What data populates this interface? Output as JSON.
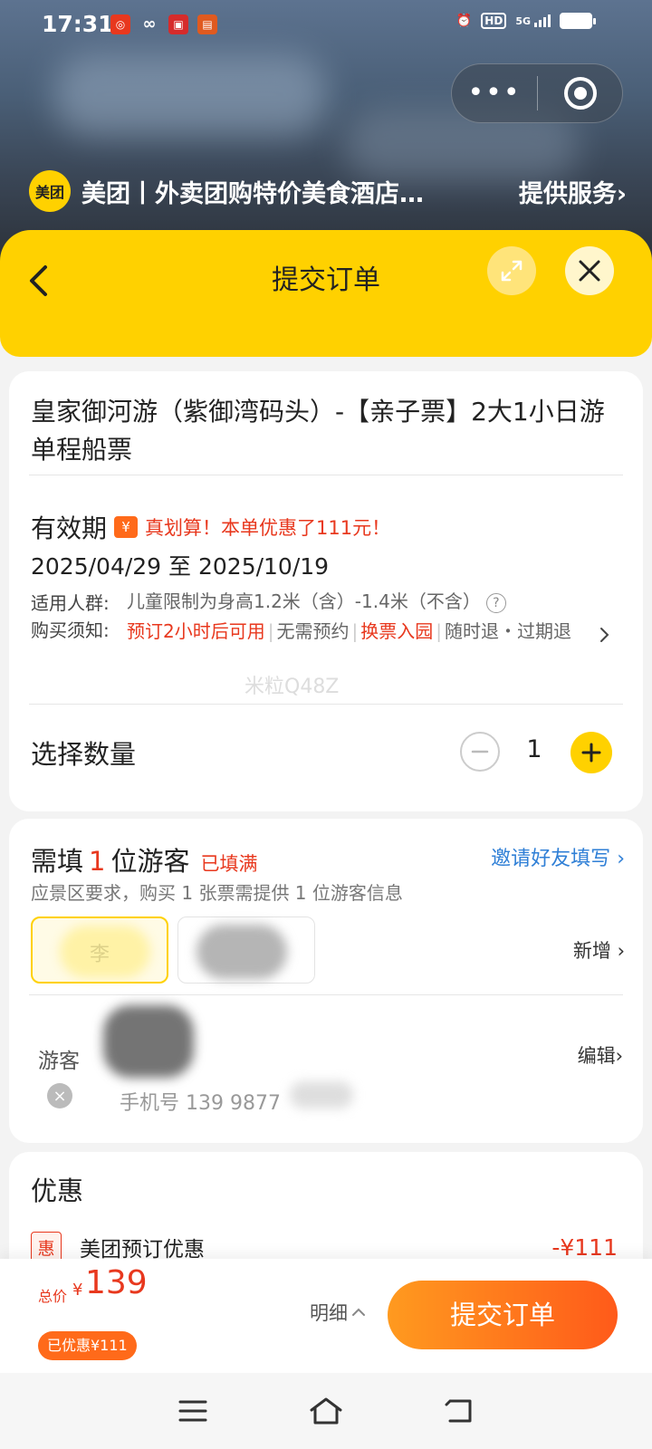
{
  "status_bar": {
    "time": "17:31",
    "notifications": [
      "app-notif-1",
      "app-notif-2",
      "app-notif-3",
      "app-notif-4"
    ],
    "hd_label": "HD",
    "network_label": "5G"
  },
  "mini_program": {
    "logo_text": "美团",
    "name": "美团丨外卖团购特价美食酒店…",
    "service_link": "提供服务"
  },
  "header": {
    "title": "提交订单"
  },
  "product": {
    "title": "皇家御河游（紫御湾码头）-【亲子票】2大1小日游单程船票",
    "validity_label": "有效期",
    "deal_icon": "¥",
    "deal_text": "真划算！本单优惠了111元！",
    "validity_dates": "2025/04/29 至 2025/10/19",
    "audience_label": "适用人群:",
    "audience_value": "儿童限制为身高1.2米（含）-1.4米（不含）",
    "notes_label": "购买须知:",
    "notes": {
      "n1": "预订2小时后可用",
      "n2": "无需预约",
      "n3": "换票入园",
      "n4": "随时退・过期退"
    },
    "watermark": "米粒Q48Z"
  },
  "quantity": {
    "label": "选择数量",
    "value": "1"
  },
  "tourists": {
    "need_prefix": "需填",
    "need_count": "1",
    "need_suffix": "位游客",
    "filled_status": "已填满",
    "invite_link": "邀请好友填写",
    "subtitle": "应景区要求，购买 1 张票需提供 1 位游客信息",
    "chip_1_name": "李",
    "add_link": "新增",
    "row_label": "游客",
    "edit_link": "编辑",
    "phone_line": "手机号 139 9877"
  },
  "promotions": {
    "title": "优惠",
    "badge": "惠",
    "name": "美团预订优惠",
    "amount": "-¥111"
  },
  "bottom_bar": {
    "total_label": "总价",
    "currency": "¥",
    "total": "139",
    "saved": "已优惠¥111",
    "detail": "明细",
    "submit": "提交订单"
  },
  "colors": {
    "brand_yellow": "#ffd100",
    "accent_red": "#e8381e",
    "cta_orange": "#ff6a1a",
    "link_blue": "#2f7fd6"
  }
}
